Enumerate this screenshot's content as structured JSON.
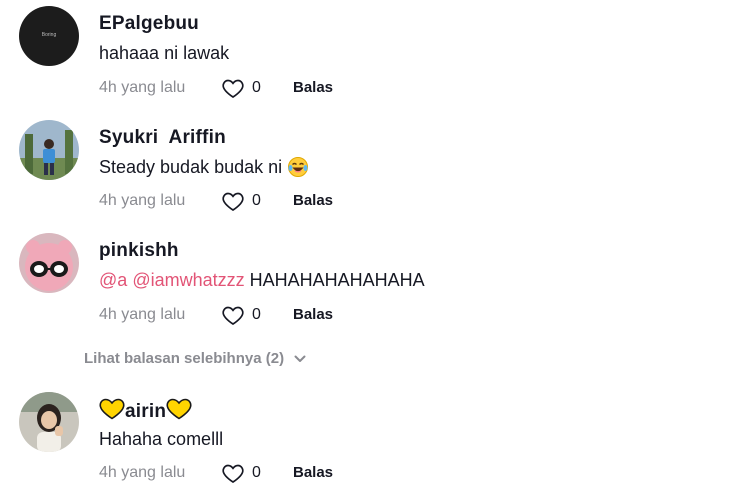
{
  "comments": [
    {
      "avatar": "boring-logo-avatar",
      "avatar_text": "Boring",
      "username": "EPalgebuu",
      "text": "hahaaa ni lawak",
      "time": "4h yang lalu",
      "likes": "0",
      "reply_label": "Balas"
    },
    {
      "avatar": "person-avatar",
      "username": "Syukri  Ariffin",
      "text": "Steady budak budak ni",
      "emoji": "tears-of-joy-emoji",
      "time": "4h yang lalu",
      "likes": "0",
      "reply_label": "Balas"
    },
    {
      "avatar": "pink-plush-avatar",
      "username": "pinkishh",
      "mention1": "@a",
      "mention2": "@iamwhatzzz",
      "text": "HAHAHAHAHAHAHA",
      "time": "4h yang lalu",
      "likes": "0",
      "reply_label": "Balas"
    },
    {
      "avatar": "person-avatar",
      "username": "airin",
      "username_decoration": "yellow-heart-icon",
      "text": "Hahaha comelll",
      "time": "4h yang lalu",
      "likes": "0",
      "reply_label": "Balas"
    }
  ],
  "view_more_replies": "Lihat balasan selebihnya (2)",
  "colors": {
    "mention": "#e25476",
    "muted": "#8a8b91",
    "heart_emoji": "#ffd400"
  }
}
